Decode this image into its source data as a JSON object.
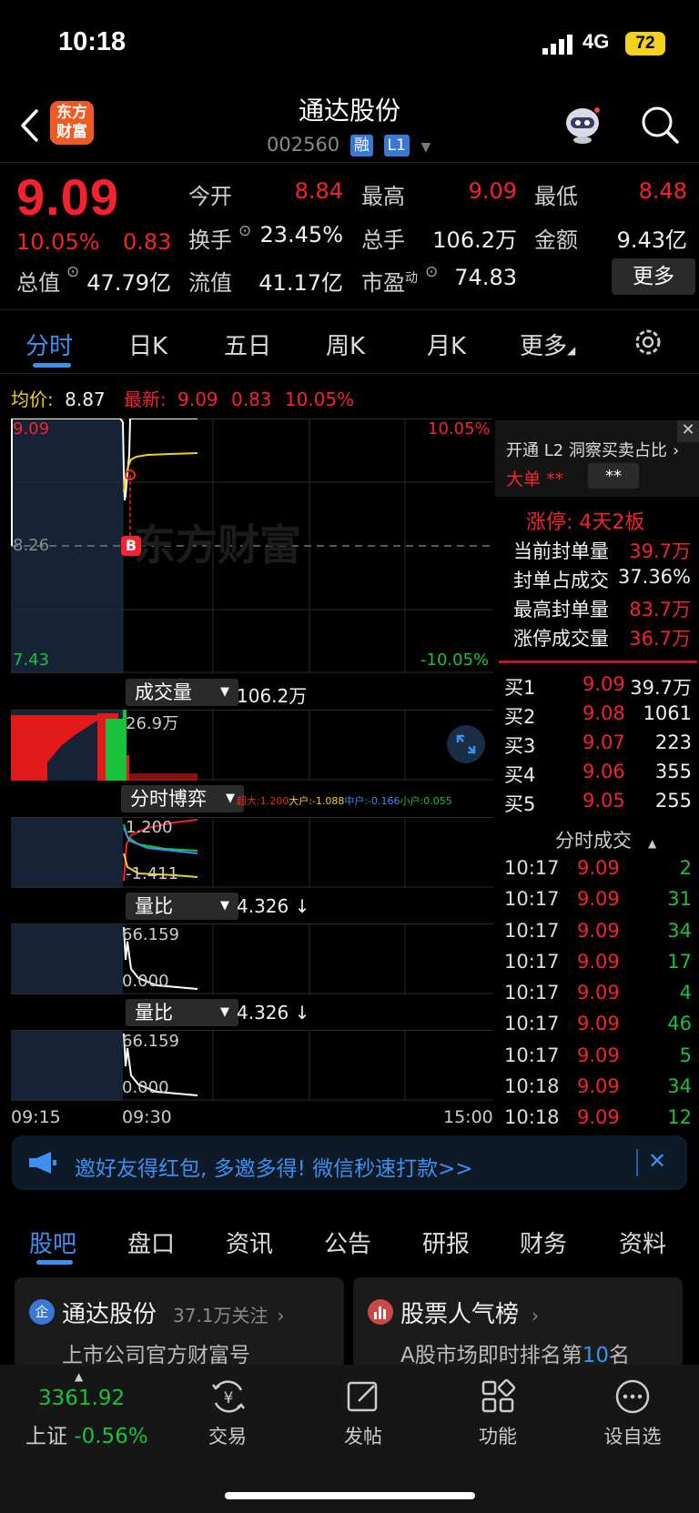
{
  "status": {
    "time": "10:18",
    "network": "4G",
    "battery": "72"
  },
  "header": {
    "logo": "东方\n财富",
    "name": "通达股份",
    "code": "002560",
    "tag1": "融",
    "tag2": "L1"
  },
  "quote": {
    "price": "9.09",
    "pct": "10.05%",
    "change": "0.83",
    "open_label": "今开",
    "open": "8.84",
    "high_label": "最高",
    "high": "9.09",
    "low_label": "最低",
    "low": "8.48",
    "turnover_label": "换手",
    "turnover": "23.45%",
    "volume_label": "总手",
    "volume": "106.2万",
    "amount_label": "金额",
    "amount": "9.43亿",
    "mcap_label": "总值",
    "mcap": "47.79亿",
    "float_label": "流值",
    "float": "41.17亿",
    "pe_label": "市盈",
    "pe_sup": "动",
    "pe": "74.83",
    "more": "更多"
  },
  "tabs": [
    "分时",
    "日K",
    "五日",
    "周K",
    "月K",
    "更多"
  ],
  "info_line": {
    "avg_label": "均价:",
    "avg": "8.87",
    "latest_label": "最新:",
    "latest": "9.09",
    "change": "0.83",
    "pct": "10.05%"
  },
  "chart": {
    "top_price": "9.09",
    "mid_price": "8.26",
    "bottom_price": "7.43",
    "top_pct": "10.05%",
    "bottom_pct": "-10.05%",
    "watermark": "东方财富",
    "b_marker": "B",
    "vol_label": "成交量",
    "vol_value": "106.2万",
    "vol_axis": "26.9万",
    "game_label": "分时博弈",
    "game_legend": {
      "big": "超大:1.200",
      "large": "大户:-1.088",
      "mid": "中户:-0.166",
      "small": "小户:0.055"
    },
    "game_top": "1.200",
    "game_bottom": "-1.411",
    "ratio1_label": "量比",
    "ratio1_value": "4.326 ↓",
    "ratio1_top": "66.159",
    "ratio1_bottom": "0.000",
    "ratio2_label": "量比",
    "ratio2_value": "4.326 ↓",
    "ratio2_top": "66.159",
    "ratio2_bottom": "0.000",
    "t_start": "09:15",
    "t_open": "09:30",
    "t_end": "15:00"
  },
  "right_panel": {
    "promo": "开通 L2 洞察买卖占比",
    "big_order_label": "大单",
    "big_order_mask": "**",
    "big_order_value": "**",
    "limit_title": "涨停: 4天2板",
    "stats": [
      {
        "label": "当前封单量",
        "value": "39.7万"
      },
      {
        "label": "封单占成交",
        "value": "37.36%"
      },
      {
        "label": "最高封单量",
        "value": "83.7万"
      },
      {
        "label": "涨停成交量",
        "value": "36.7万"
      }
    ],
    "bids": [
      {
        "label": "买1",
        "price": "9.09",
        "vol": "39.7万"
      },
      {
        "label": "买2",
        "price": "9.08",
        "vol": "1061"
      },
      {
        "label": "买3",
        "price": "9.07",
        "vol": "223"
      },
      {
        "label": "买4",
        "price": "9.06",
        "vol": "355"
      },
      {
        "label": "买5",
        "price": "9.05",
        "vol": "255"
      }
    ],
    "ticks_title": "分时成交",
    "ticks": [
      {
        "time": "10:17",
        "price": "9.09",
        "vol": "2"
      },
      {
        "time": "10:17",
        "price": "9.09",
        "vol": "31"
      },
      {
        "time": "10:17",
        "price": "9.09",
        "vol": "34"
      },
      {
        "time": "10:17",
        "price": "9.09",
        "vol": "17"
      },
      {
        "time": "10:17",
        "price": "9.09",
        "vol": "4"
      },
      {
        "time": "10:17",
        "price": "9.09",
        "vol": "46"
      },
      {
        "time": "10:17",
        "price": "9.09",
        "vol": "5"
      },
      {
        "time": "10:18",
        "price": "9.09",
        "vol": "34"
      },
      {
        "time": "10:18",
        "price": "9.09",
        "vol": "12"
      }
    ]
  },
  "banner": {
    "text": "邀好友得红包, 多邀多得! 微信秒速打款>>"
  },
  "bottom_tabs": [
    "股吧",
    "盘口",
    "资讯",
    "公告",
    "研报",
    "财务",
    "资料"
  ],
  "cards": [
    {
      "icon": "企",
      "title": "通达股份",
      "meta": "37.1万关注",
      "subtitle": "上市公司官方财富号"
    },
    {
      "title": "股票人气榜",
      "subtitle_pre": "A股市场即时排名第",
      "rank": "10",
      "subtitle_post": "名"
    }
  ],
  "bottom_bar": {
    "index_value": "3361.92",
    "index_name": "上证",
    "index_pct": "-0.56%",
    "items": [
      "交易",
      "发帖",
      "功能",
      "设自选"
    ]
  }
}
